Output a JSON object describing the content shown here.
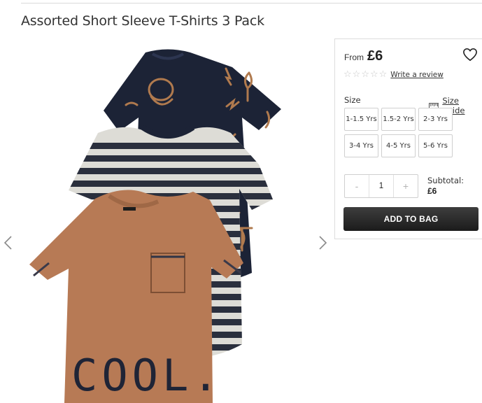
{
  "product": {
    "title": "Assorted Short Sleeve T-Shirts 3 Pack",
    "image_alt": "3 pack of t-shirts: navy printed, grey striped and tan COOL. print",
    "print_text": "COOL.",
    "from_label": "From",
    "price": "£6",
    "rating": 0,
    "rating_max": 5,
    "write_review_label": "Write a review"
  },
  "size": {
    "label": "Size",
    "guide_label": "Size guide",
    "options": [
      "1-1.5 Yrs",
      "1.5-2 Yrs",
      "2-3 Yrs",
      "3-4 Yrs",
      "4-5 Yrs",
      "5-6 Yrs"
    ]
  },
  "quantity": {
    "minus": "-",
    "value": "1",
    "plus": "+"
  },
  "subtotal": {
    "label": "Subtotal:",
    "value": "£6"
  },
  "cta": {
    "add_to_bag_label": "ADD TO BAG"
  },
  "icons": {
    "prev": "chevron-left-icon",
    "next": "chevron-right-icon",
    "wishlist": "heart-icon",
    "size_guide": "ruler-icon",
    "star": "star-outline-icon"
  },
  "colors": {
    "navy_tee": "#1c2336",
    "print_tan": "#b07a4e",
    "tan_tee": "#b77a55",
    "stripe_dark": "#2a2f3d",
    "stripe_light": "#dddcd6",
    "button_dark": "#222222"
  }
}
